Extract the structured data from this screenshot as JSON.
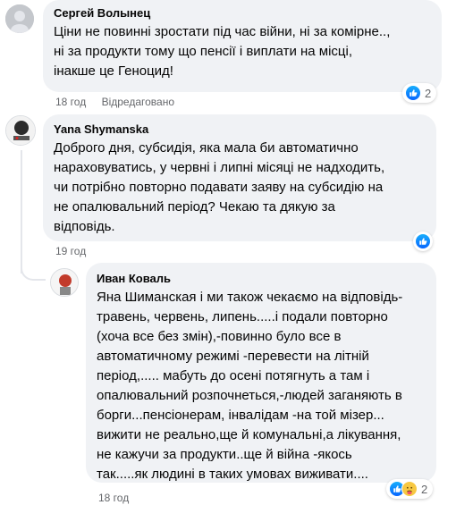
{
  "comments": [
    {
      "author": "Сергей Волынец",
      "lines": [
        "Ціни не повинні зростати під час війни, ні за комірне..,",
        "ні за продукти тому що пенсії і виплати на місці,",
        "інакше це Геноцид!"
      ],
      "time": "18 год",
      "edited": "Відредаговано",
      "reaction_count": "2",
      "reaction_icons": [
        "like-icon"
      ]
    },
    {
      "author": "Yana Shymanska",
      "lines": [
        "Доброго дня, субсидія, яка мала би автоматично",
        "нараховуватись, у червні і липні місяці не надходить,",
        "чи потрібно повторно подавати заяву на субсидію на",
        "не опалювальний період? Чекаю та дякую за",
        "відповідь."
      ],
      "time": "19 год",
      "reaction_icons": [
        "like-icon"
      ]
    },
    {
      "author": "Иван Коваль",
      "lines": [
        "Яна Шиманская і ми також чекаємо на відповідь-",
        "травень, червень, липень.....і подали повторно",
        "(хоча все без змін),-повинно було все в",
        "автоматичному режимі -перевести на літній",
        "період,..... мабуть до осені потягнуть а там і",
        "опалювальний розпочнеться,-людей заганяють в",
        "борги...пенсіонерам, інвалідам -на той мізер...",
        "вижити не реально,ще й комунальні,а лікування,",
        "не кажучи за продукти..ще й війна -якось",
        "так.....як людині в таких умовах виживати...."
      ],
      "time": "18 год",
      "reaction_count": "2",
      "reaction_icons": [
        "like-icon",
        "care-icon"
      ]
    }
  ],
  "colors": {
    "bubble": "#f0f2f5",
    "meta": "#65676b",
    "like": "#0866ff",
    "care": "#f7c842"
  }
}
